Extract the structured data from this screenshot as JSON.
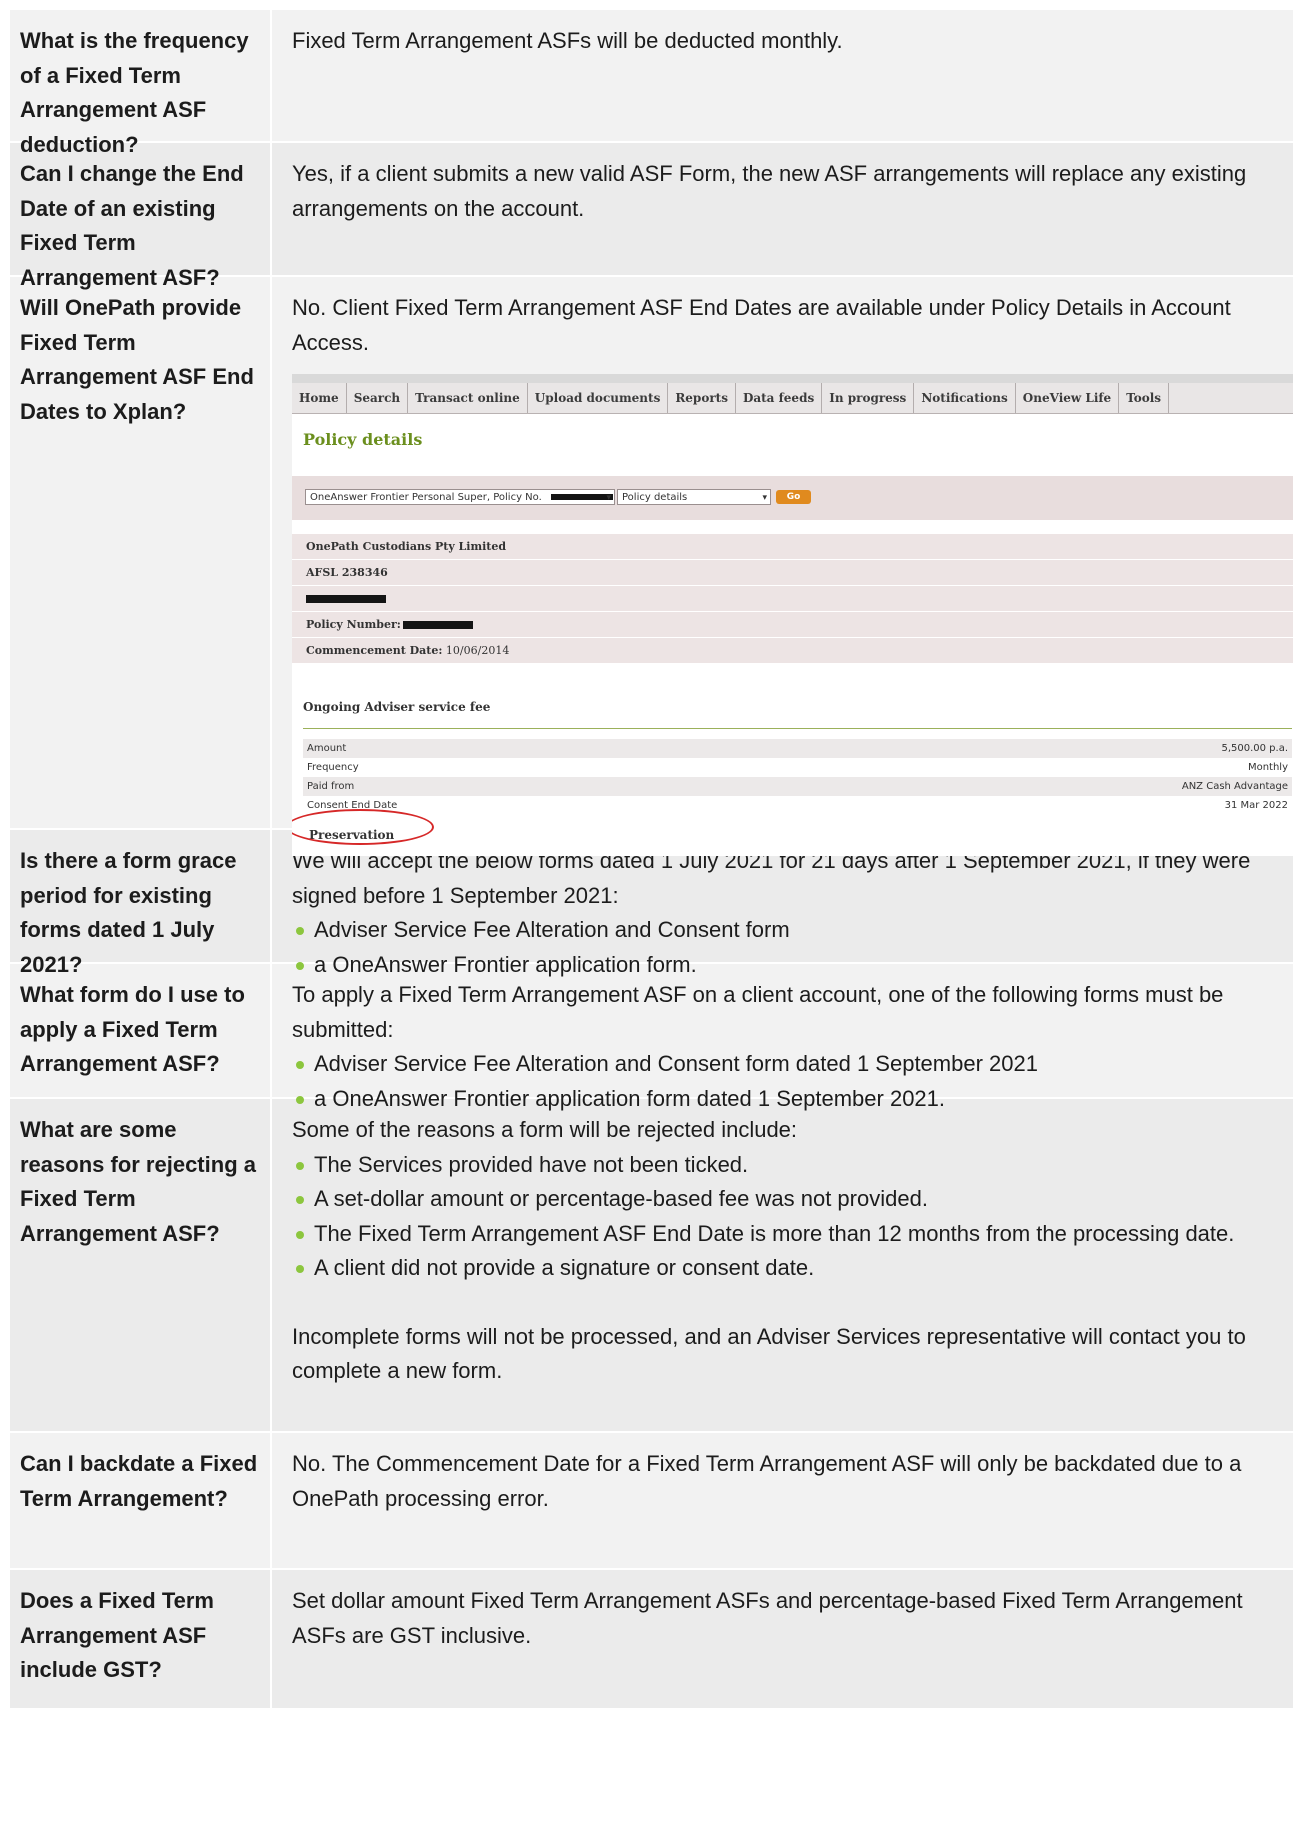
{
  "faq": [
    {
      "question": "What is the frequency of a Fixed Term Arrangement ASF deduction?",
      "answer_paragraphs": [
        "Fixed Term Arrangement ASFs will be deducted monthly."
      ]
    },
    {
      "question": "Can I change the End Date of an existing Fixed Term Arrangement ASF?",
      "answer_paragraphs": [
        "Yes, if a client submits a new valid ASF Form, the new ASF arrangements will replace any existing arrangements on the account."
      ]
    },
    {
      "question": "Will OnePath provide Fixed Term Arrangement ASF End Dates to Xplan?",
      "answer_paragraphs": [
        "No. Client Fixed Term Arrangement ASF End Dates are available under Policy Details in Account Access."
      ]
    },
    {
      "question": "Is there a form grace period for existing forms dated 1 July 2021?",
      "answer_paragraphs": [
        "We will accept the below forms dated 1 July 2021 for 21 days after 1 September 2021, if they were signed before 1 September 2021:"
      ],
      "bullets": [
        "Adviser Service Fee Alteration and Consent form",
        "a OneAnswer Frontier application form."
      ]
    },
    {
      "question": "What form do I use to apply a Fixed Term Arrangement ASF?",
      "answer_paragraphs": [
        "To apply a Fixed Term Arrangement ASF on a client account, one of the following forms must be submitted:"
      ],
      "bullets": [
        "Adviser Service Fee Alteration and Consent form dated 1 September 2021",
        "a OneAnswer Frontier application form dated 1 September 2021."
      ]
    },
    {
      "question": "What are some reasons for rejecting a Fixed Term Arrangement ASF?",
      "answer_paragraphs": [
        "Some of the reasons a form will be rejected include:"
      ],
      "bullets": [
        "The Services provided have not been ticked.",
        "A set-dollar amount or percentage-based fee was not provided.",
        "The Fixed Term Arrangement ASF End Date is more than 12 months from the processing date.",
        "A client did not provide a signature or consent date."
      ],
      "closing": "Incomplete forms will not be processed, and an Adviser Services representative will contact you to complete a new form."
    },
    {
      "question": "Can I backdate a Fixed Term Arrangement?",
      "answer_paragraphs": [
        "No. The Commencement Date for a Fixed Term Arrangement ASF will only be backdated due to a OnePath processing error."
      ]
    },
    {
      "question": "Does a Fixed Term Arrangement ASF include GST?",
      "answer_paragraphs": [
        "Set dollar amount Fixed Term Arrangement ASFs and percentage-based Fixed Term Arrangement ASFs are GST inclusive."
      ]
    }
  ],
  "screenshot": {
    "nav": [
      "Home",
      "Search",
      "Transact online",
      "Upload documents",
      "Reports",
      "Data feeds",
      "In progress",
      "Notifications",
      "OneView Life",
      "Tools"
    ],
    "title": "Policy details",
    "policy_select": "OneAnswer Frontier Personal Super, Policy No.",
    "view_select": "Policy details",
    "go_label": "Go",
    "company": "OnePath Custodians Pty Limited",
    "afsl": "AFSL 238346",
    "policy_number_label": "Policy Number:",
    "commencement_label": "Commencement Date:",
    "commencement_value": "10/06/2014",
    "fee_section_title": "Ongoing Adviser service fee",
    "fee_rows": [
      {
        "label": "Amount",
        "value": "5,500.00 p.a."
      },
      {
        "label": "Frequency",
        "value": "Monthly"
      },
      {
        "label": "Paid from",
        "value": "ANZ Cash Advantage"
      },
      {
        "label": "Consent End Date",
        "value": "31 Mar 2022"
      }
    ],
    "next_section": "Preservation"
  },
  "colors": {
    "bullet": "#8cc63e",
    "row_light": "#f2f2f2",
    "row_dark": "#ebebeb",
    "title_green": "#6b8f1e",
    "highlight_ring": "#d62828",
    "go_button": "#e08a1e"
  },
  "icons": [
    "select-dropdown-icon",
    "highlight-ring"
  ]
}
